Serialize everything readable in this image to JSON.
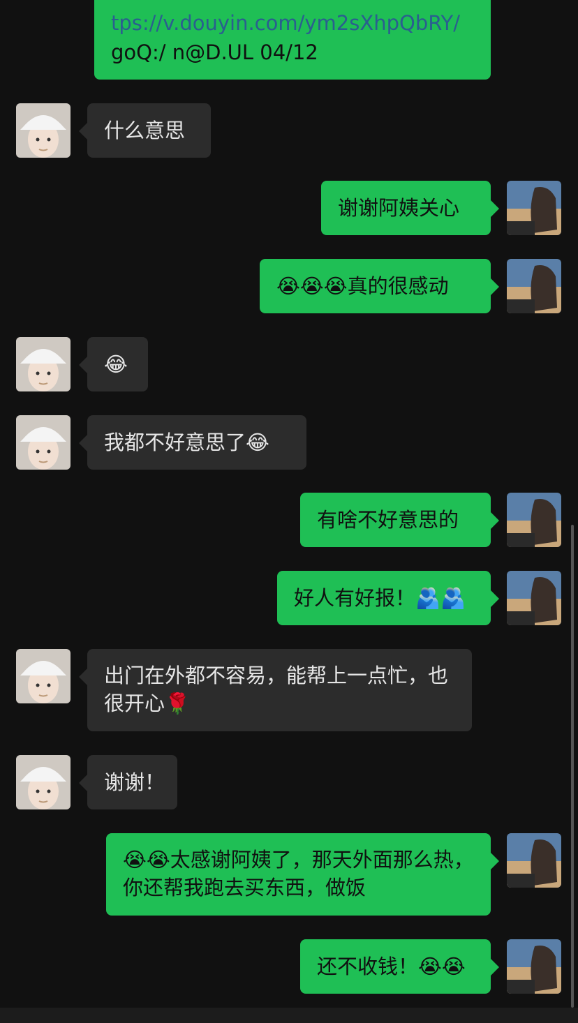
{
  "messages": [
    {
      "id": "m0",
      "side": "right",
      "lines": [
        "tps://v.douyin.com/ym2sXhpQbRY/",
        "goQ:/ n@D.UL 04/12"
      ]
    },
    {
      "id": "m1",
      "side": "left",
      "text": "什么意思"
    },
    {
      "id": "m2",
      "side": "right",
      "text": "谢谢阿姨关心"
    },
    {
      "id": "m3",
      "side": "right",
      "text": "😭😭😭真的很感动"
    },
    {
      "id": "m4",
      "side": "left",
      "text": "😂"
    },
    {
      "id": "m5",
      "side": "left",
      "text": "我都不好意思了😂"
    },
    {
      "id": "m6",
      "side": "right",
      "text": "有啥不好意思的"
    },
    {
      "id": "m7",
      "side": "right",
      "text": "好人有好报！🫂🫂"
    },
    {
      "id": "m8",
      "side": "left",
      "text": "出门在外都不容易，能帮上一点忙，也很开心🌹"
    },
    {
      "id": "m9",
      "side": "left",
      "text": "谢谢！"
    },
    {
      "id": "m10",
      "side": "right",
      "text": "😭😭太感谢阿姨了，那天外面那么热，你还帮我跑去买东西，做饭"
    },
    {
      "id": "m11",
      "side": "right",
      "text": "还不收钱！😭😭"
    }
  ],
  "colors": {
    "background": "#111111",
    "left_bubble": "#2c2c2c",
    "right_bubble": "#1fbf55",
    "link": "#2a5f8f"
  },
  "icons": {
    "left_avatar": "woman-cap-avatar",
    "right_avatar": "man-photo-avatar"
  }
}
